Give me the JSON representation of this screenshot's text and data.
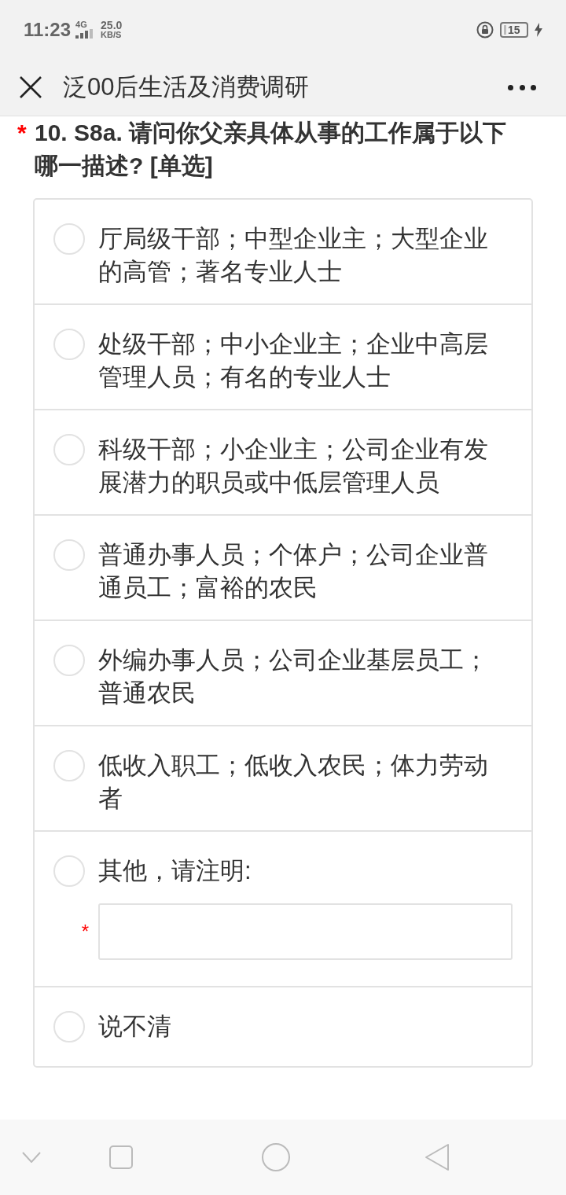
{
  "status_bar": {
    "time": "11:23",
    "network": "4G",
    "speed": "25.0",
    "speed_unit": "KB/S",
    "battery": "15",
    "charging": true
  },
  "header": {
    "title": "泛00后生活及消费调研"
  },
  "question": {
    "required_mark": "*",
    "title": "10. S8a. 请问你父亲具体从事的工作属于以下哪一描述? [单选]"
  },
  "options": [
    {
      "kind": "radio",
      "label": "厅局级干部；中型企业主；大型企业的高管；著名专业人士",
      "selected": false
    },
    {
      "kind": "radio",
      "label": "处级干部；中小企业主；企业中高层管理人员；有名的专业人士",
      "selected": false
    },
    {
      "kind": "radio",
      "label": "科级干部；小企业主；公司企业有发展潜力的职员或中低层管理人员",
      "selected": false
    },
    {
      "kind": "radio",
      "label": "普通办事人员；个体户；公司企业普通员工；富裕的农民",
      "selected": false
    },
    {
      "kind": "radio",
      "label": "外编办事人员；公司企业基层员工；普通农民",
      "selected": false
    },
    {
      "kind": "radio",
      "label": "低收入职工；低收入农民；体力劳动者",
      "selected": false
    },
    {
      "kind": "radio_with_input",
      "label": "其他，请注明:",
      "selected": false,
      "input_required_mark": "*"
    },
    {
      "kind": "radio",
      "label": "说不清",
      "selected": false
    }
  ]
}
